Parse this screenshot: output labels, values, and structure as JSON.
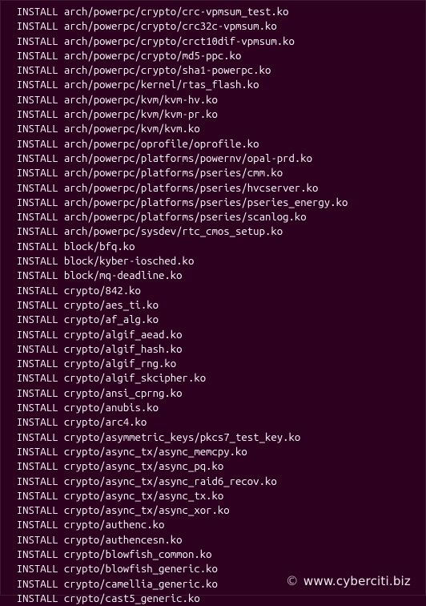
{
  "terminal": {
    "prefix": "  INSTALL ",
    "lines": [
      "arch/powerpc/crypto/crc-vpmsum_test.ko",
      "arch/powerpc/crypto/crc32c-vpmsum.ko",
      "arch/powerpc/crypto/crct10dif-vpmsum.ko",
      "arch/powerpc/crypto/md5-ppc.ko",
      "arch/powerpc/crypto/sha1-powerpc.ko",
      "arch/powerpc/kernel/rtas_flash.ko",
      "arch/powerpc/kvm/kvm-hv.ko",
      "arch/powerpc/kvm/kvm-pr.ko",
      "arch/powerpc/kvm/kvm.ko",
      "arch/powerpc/oprofile/oprofile.ko",
      "arch/powerpc/platforms/powernv/opal-prd.ko",
      "arch/powerpc/platforms/pseries/cmm.ko",
      "arch/powerpc/platforms/pseries/hvcserver.ko",
      "arch/powerpc/platforms/pseries/pseries_energy.ko",
      "arch/powerpc/platforms/pseries/scanlog.ko",
      "arch/powerpc/sysdev/rtc_cmos_setup.ko",
      "block/bfq.ko",
      "block/kyber-iosched.ko",
      "block/mq-deadline.ko",
      "crypto/842.ko",
      "crypto/aes_ti.ko",
      "crypto/af_alg.ko",
      "crypto/algif_aead.ko",
      "crypto/algif_hash.ko",
      "crypto/algif_rng.ko",
      "crypto/algif_skcipher.ko",
      "crypto/ansi_cprng.ko",
      "crypto/anubis.ko",
      "crypto/arc4.ko",
      "crypto/asymmetric_keys/pkcs7_test_key.ko",
      "crypto/async_tx/async_memcpy.ko",
      "crypto/async_tx/async_pq.ko",
      "crypto/async_tx/async_raid6_recov.ko",
      "crypto/async_tx/async_tx.ko",
      "crypto/async_tx/async_xor.ko",
      "crypto/authenc.ko",
      "crypto/authencesn.ko",
      "crypto/blowfish_common.ko",
      "crypto/blowfish_generic.ko",
      "crypto/camellia_generic.ko",
      "crypto/cast5_generic.ko"
    ]
  },
  "watermark": {
    "copyright_symbol": "©",
    "text": "www.cyberciti.biz"
  }
}
